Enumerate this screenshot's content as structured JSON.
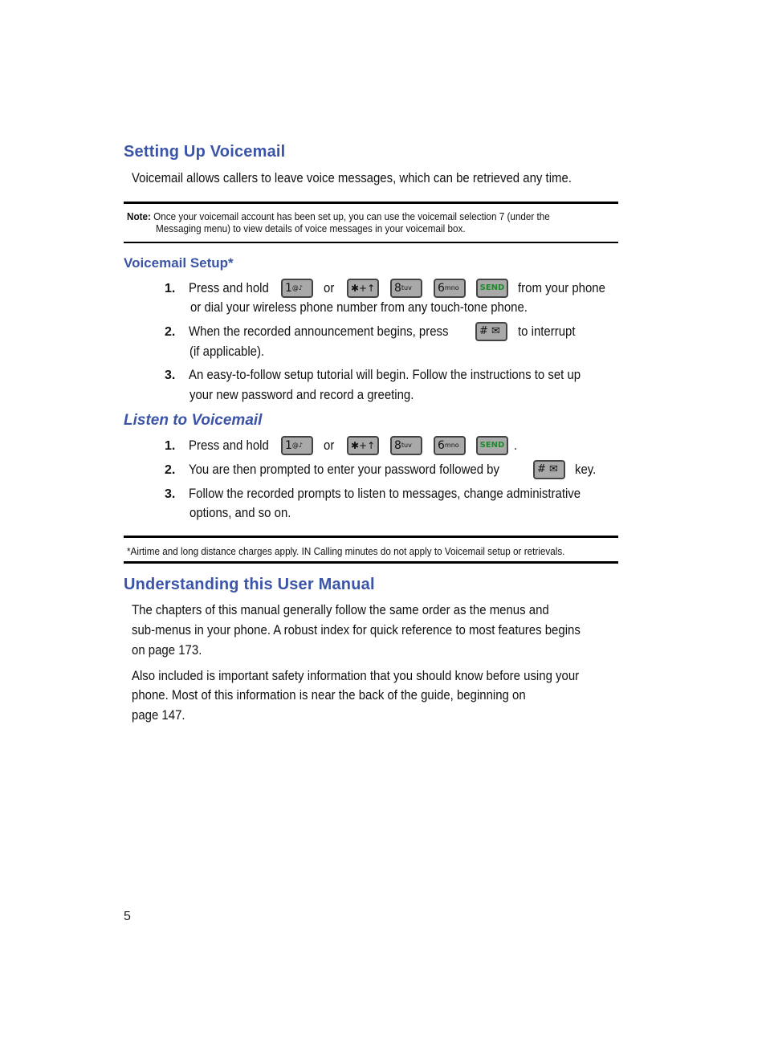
{
  "section1": {
    "title": "Setting Up Voicemail",
    "intro": "Voicemail allows callers to leave voice messages, which can be retrieved any time.",
    "note_label": "Note:",
    "note_line1": "Once your voicemail account has been set up, you can use the voicemail selection 7 (under the",
    "note_line2": "Messaging menu) to view details of voice messages in your voicemail box."
  },
  "setup": {
    "title": "Voicemail Setup*",
    "steps": [
      {
        "num": "1.",
        "line1a": "Press and hold",
        "or": "or",
        "line1b": "from your phone",
        "line2": "or dial your wireless phone number from any touch-tone phone."
      },
      {
        "num": "2.",
        "line1a": "When the recorded announcement begins, press",
        "line1b": "to interrupt",
        "line2": "(if applicable)."
      },
      {
        "num": "3.",
        "line1": "An easy-to-follow setup tutorial will begin. Follow the instructions to set up",
        "line2": "your new password and record a greeting."
      }
    ]
  },
  "listen": {
    "title": "Listen to Voicemail",
    "steps": [
      {
        "num": "1.",
        "line1a": "Press and hold",
        "or": "or",
        "end": "."
      },
      {
        "num": "2.",
        "line1a": "You are then prompted to enter your password followed by",
        "line1b": "key."
      },
      {
        "num": "3.",
        "line1": "Follow the recorded prompts to listen to messages, change administrative",
        "line2": "options, and so on."
      }
    ]
  },
  "keys": {
    "one": "1",
    "one_sub": "@♪",
    "star": "✱+↑",
    "eight": "8",
    "eight_sub": "tuv",
    "six": "6",
    "six_sub": "mno",
    "send": "SEND",
    "hash": "# ✉"
  },
  "footnote": "*Airtime and long distance charges apply. IN Calling minutes do not apply to Voicemail setup or retrievals.",
  "section2": {
    "title": "Understanding this User Manual",
    "p1": [
      "The chapters of this manual generally follow the same order as the menus and",
      "sub-menus in your phone. A robust index for quick reference to most features begins",
      "on page 173."
    ],
    "p2": [
      "Also included is important safety information that you should know before using your",
      "phone. Most of this information is near the back of the guide, beginning on",
      "page 147."
    ]
  },
  "page_number": "5"
}
